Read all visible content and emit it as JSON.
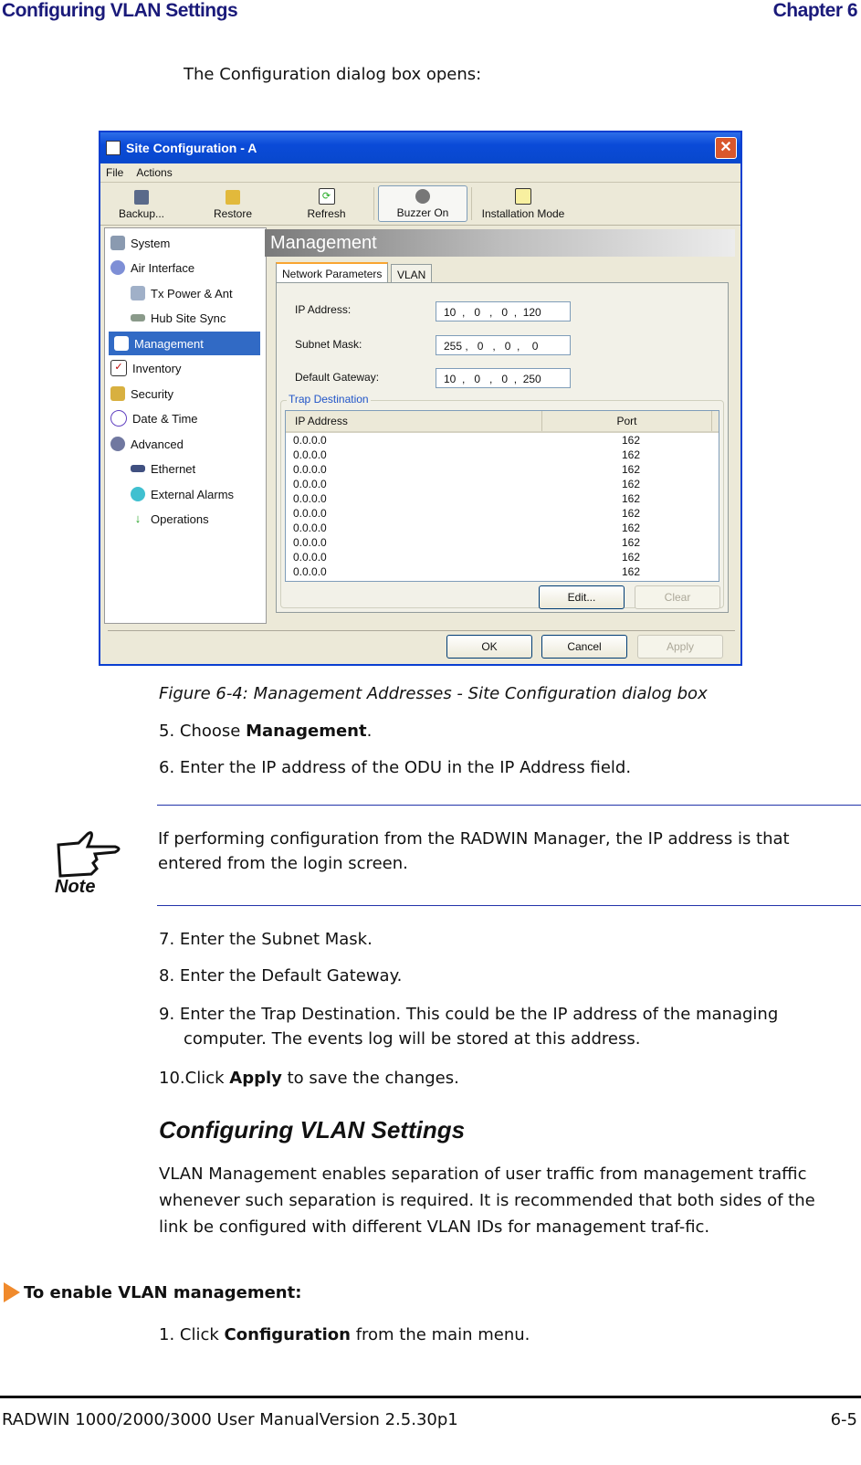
{
  "page_header": {
    "left": "Configuring VLAN Settings",
    "right": "Chapter 6"
  },
  "intro": "The Configuration dialog box opens:",
  "dialog": {
    "title": "Site Configuration - A",
    "menu": [
      "File",
      "Actions"
    ],
    "toolbar": [
      {
        "label": "Backup...",
        "icon": "floppy-disk-icon"
      },
      {
        "label": "Restore",
        "icon": "restore-arrow-icon"
      },
      {
        "label": "Refresh",
        "icon": "refresh-icon"
      },
      {
        "label": "Buzzer On",
        "icon": "speaker-icon"
      },
      {
        "label": "Installation Mode",
        "icon": "installation-icon"
      }
    ],
    "tree": [
      {
        "label": "System",
        "icon": "system-icon",
        "level": 0
      },
      {
        "label": "Air Interface",
        "icon": "air-interface-icon",
        "level": 0
      },
      {
        "label": "Tx Power & Ant",
        "icon": "antenna-icon",
        "level": 1
      },
      {
        "label": "Hub Site Sync",
        "icon": "sync-icon",
        "level": 1
      },
      {
        "label": "Management",
        "icon": "management-icon",
        "level": 0,
        "selected": true
      },
      {
        "label": "Inventory",
        "icon": "inventory-icon",
        "level": 0
      },
      {
        "label": "Security",
        "icon": "keys-icon",
        "level": 0
      },
      {
        "label": "Date & Time",
        "icon": "clock-icon",
        "level": 0
      },
      {
        "label": "Advanced",
        "icon": "gear-icon",
        "level": 0
      },
      {
        "label": "Ethernet",
        "icon": "ethernet-icon",
        "level": 1
      },
      {
        "label": "External Alarms",
        "icon": "alarm-icon",
        "level": 1
      },
      {
        "label": "Operations",
        "icon": "operations-arrow-icon",
        "level": 1
      }
    ],
    "section_title": "Management",
    "tabs": [
      {
        "label": "Network Parameters",
        "active": true
      },
      {
        "label": "VLAN",
        "active": false
      }
    ],
    "fields": {
      "ip_label": "IP Address:",
      "ip_value": "10  ,   0   ,   0  ,  120",
      "mask_label": "Subnet Mask:",
      "mask_value": "255 ,   0   ,   0  ,    0",
      "gw_label": "Default Gateway:",
      "gw_value": "10  ,   0   ,   0  ,  250"
    },
    "trap": {
      "title": "Trap Destination",
      "columns": [
        "IP Address",
        "Port"
      ],
      "rows": [
        [
          "0.0.0.0",
          "162"
        ],
        [
          "0.0.0.0",
          "162"
        ],
        [
          "0.0.0.0",
          "162"
        ],
        [
          "0.0.0.0",
          "162"
        ],
        [
          "0.0.0.0",
          "162"
        ],
        [
          "0.0.0.0",
          "162"
        ],
        [
          "0.0.0.0",
          "162"
        ],
        [
          "0.0.0.0",
          "162"
        ],
        [
          "0.0.0.0",
          "162"
        ],
        [
          "0.0.0.0",
          "162"
        ]
      ],
      "edit": "Edit...",
      "clear": "Clear"
    },
    "buttons": {
      "ok": "OK",
      "cancel": "Cancel",
      "apply": "Apply"
    }
  },
  "caption": "Figure 6-4: Management Addresses - Site Configuration dialog box",
  "steps_a": [
    {
      "num": "5.",
      "pre": "Choose ",
      "bold": "Management",
      "post": "."
    },
    {
      "num": "6.",
      "pre": "Enter the IP address of the ODU in the IP Address field.",
      "bold": "",
      "post": ""
    }
  ],
  "note": {
    "label": "Note",
    "text": "If performing configuration from the RADWIN Manager, the IP address is that entered from the login screen."
  },
  "steps_b": [
    {
      "num": "7.",
      "text": "Enter the Subnet Mask."
    },
    {
      "num": "8.",
      "text": "Enter the Default Gateway."
    },
    {
      "num": "9.",
      "text": "Enter the Trap Destination. This could be the IP address of the managing computer. The events log will be stored at this address."
    }
  ],
  "step10": {
    "num": "10.",
    "pre": "Click ",
    "bold": "Apply",
    "post": " to save the changes."
  },
  "section_heading": "Configuring VLAN Settings",
  "section_body": "VLAN Management enables separation of user traffic from management traffic whenever such separation is required. It is recommended that both sides of the link be configured with different VLAN IDs for management traf-fic.",
  "procedure_title": "To enable VLAN management:",
  "step1": {
    "num": "1.",
    "pre": "Click ",
    "bold": "Configuration",
    "post": " from the main menu."
  },
  "footer": {
    "left": "RADWIN 1000/2000/3000 User ManualVersion  2.5.30p1",
    "right": "6-5"
  }
}
